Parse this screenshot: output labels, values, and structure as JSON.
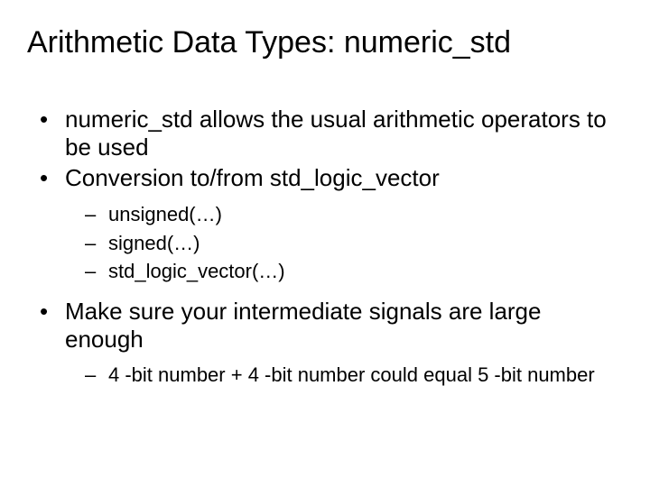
{
  "title": "Arithmetic Data Types: numeric_std",
  "bullets": {
    "b0": "numeric_std allows the usual arithmetic operators to be used",
    "b1": "Conversion to/from std_logic_vector",
    "b1_sub": {
      "s0": "unsigned(…)",
      "s1": "signed(…)",
      "s2": "std_logic_vector(…)"
    },
    "b2": "Make sure your intermediate signals are large enough",
    "b2_sub": {
      "s0": "4 -bit number + 4 -bit number could equal 5 -bit number"
    }
  }
}
